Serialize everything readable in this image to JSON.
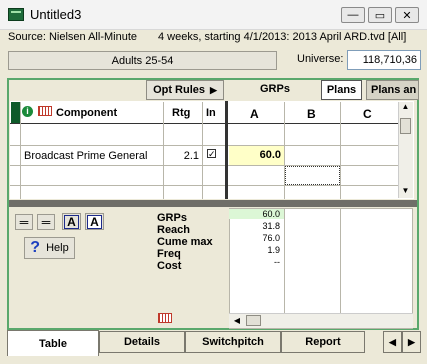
{
  "window": {
    "title": "Untitled3",
    "buttons": {
      "minimize": "—",
      "restore": "▭",
      "close": "✕"
    }
  },
  "info": {
    "source": "Source: Nielsen All-Minute",
    "period": "4 weeks, starting 4/1/2013: 2013 April ARD.tvd [All]"
  },
  "header": {
    "demo_button": "Adults 25-54",
    "universe_label": "Universe:",
    "universe_value": "118,710,36"
  },
  "tabs_top": {
    "opt_rules": "Opt Rules",
    "grps": "GRPs",
    "plans": "Plans",
    "plans_and": "Plans an"
  },
  "grid": {
    "col_component": "Component",
    "col_rtg": "Rtg",
    "col_in": "In",
    "plan_cols": [
      "A",
      "B",
      "C"
    ],
    "row_component": "Broadcast Prime General",
    "row_rtg": "2.1",
    "row_in_checked": true,
    "row_value_a": "60.0"
  },
  "summary": {
    "labels": [
      "GRPs",
      "Reach",
      "Cume max",
      "Freq",
      "Cost"
    ],
    "values": [
      "60.0",
      "31.8",
      "76.0",
      "1.9",
      "--"
    ]
  },
  "help_label": "Help",
  "bottom_tabs": [
    "Table",
    "Details",
    "Switchpitch",
    "Report"
  ],
  "colors": {
    "frame_green": "#5aa86c",
    "highlight_yellow": "#ffffc8",
    "highlight_green": "#dcf7d6"
  }
}
